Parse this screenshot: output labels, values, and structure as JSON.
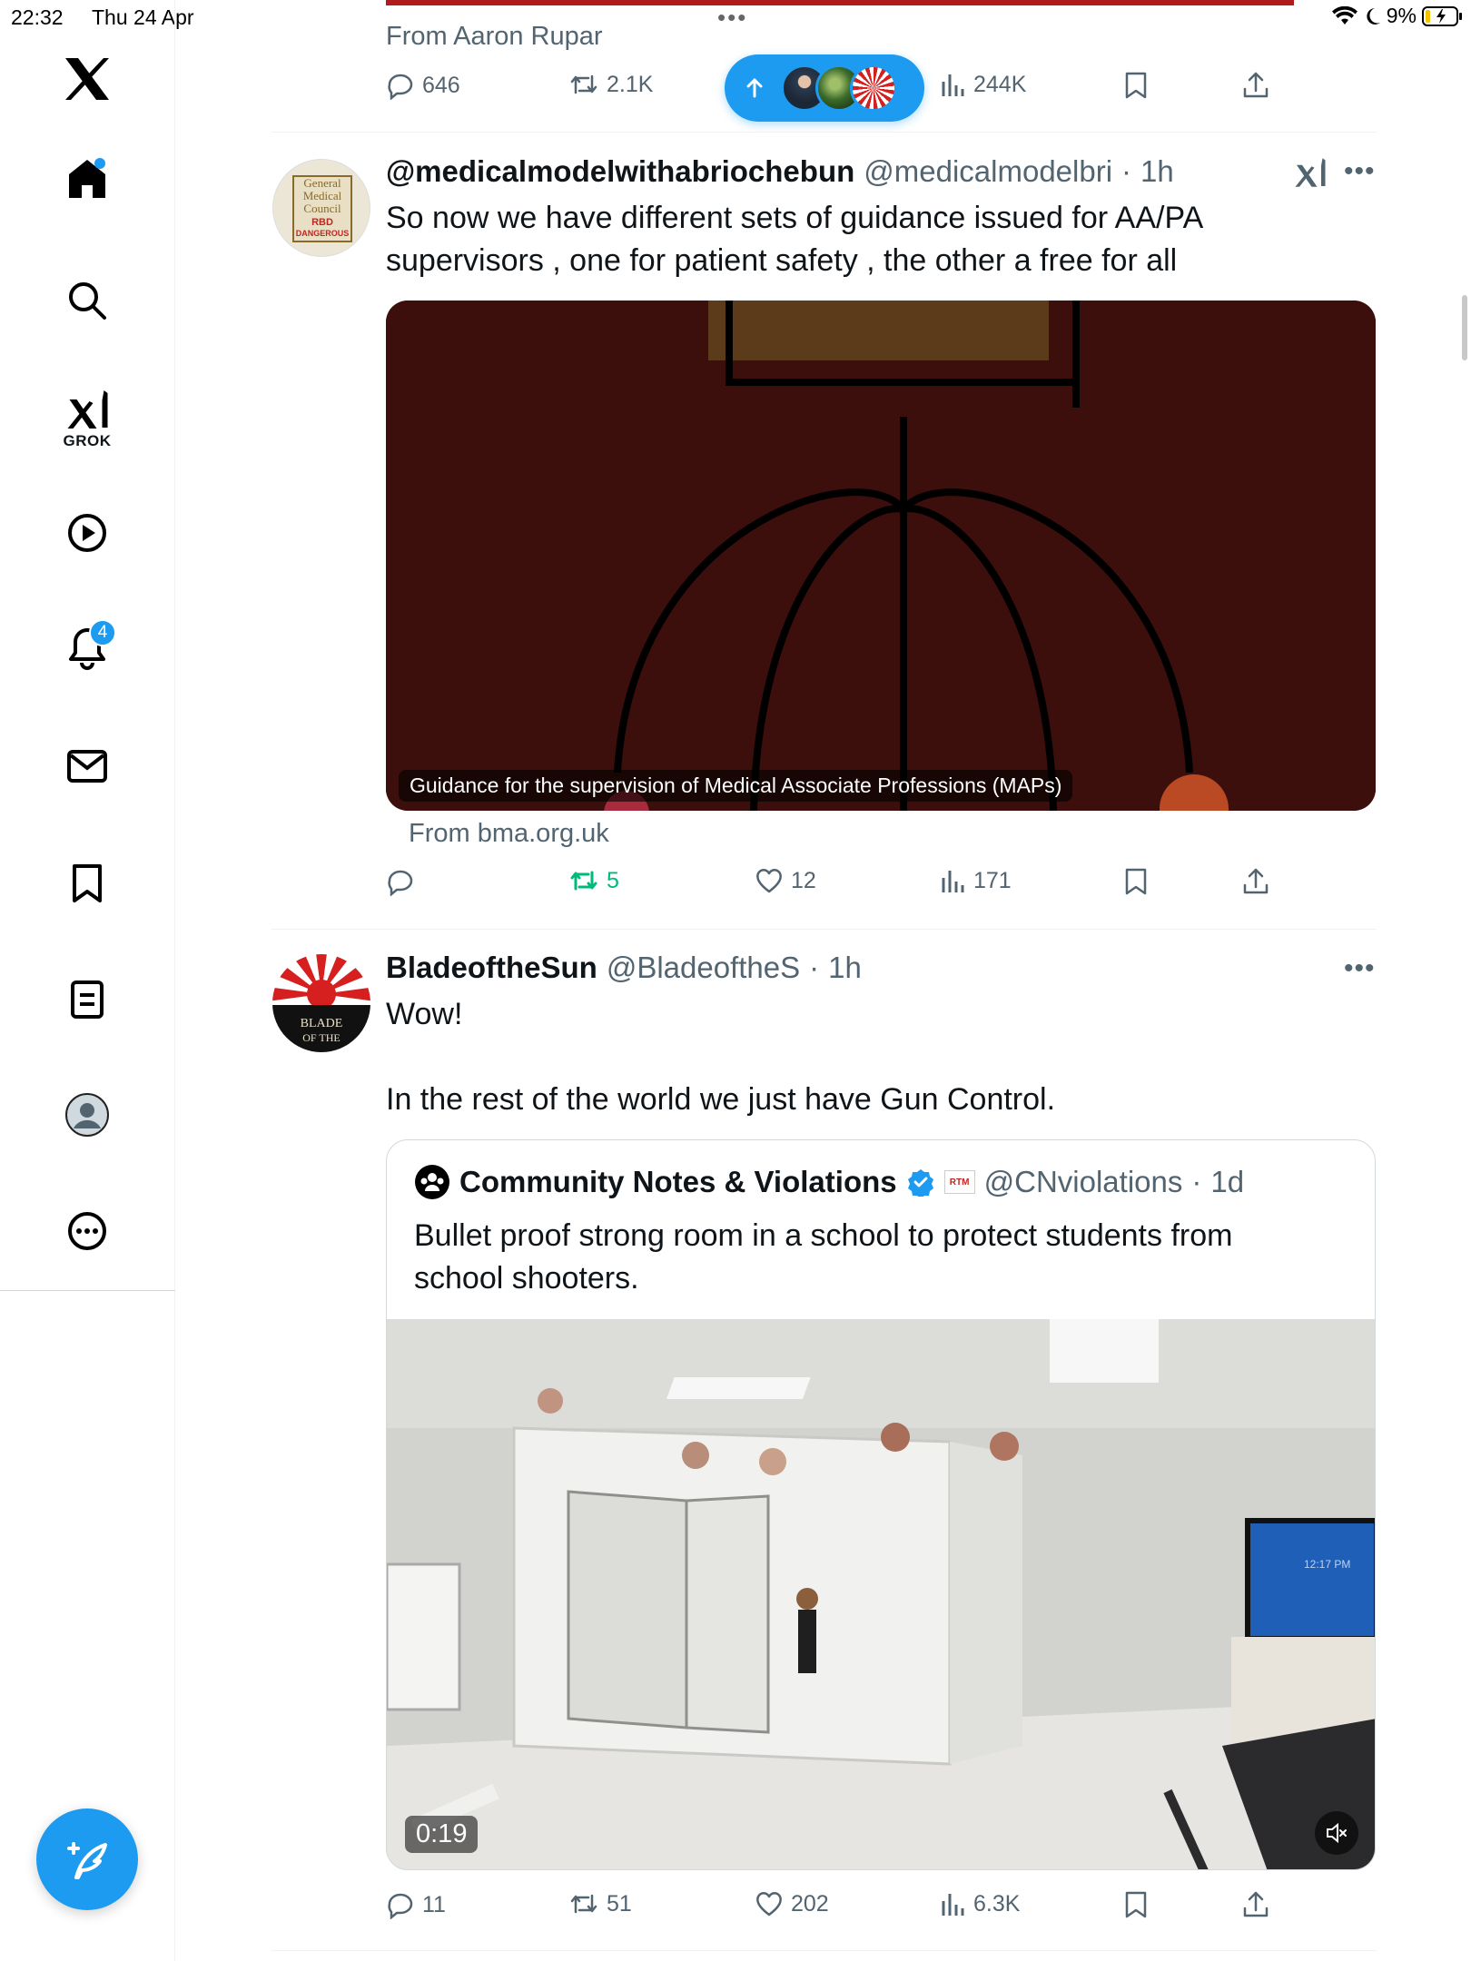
{
  "status_bar": {
    "time": "22:32",
    "date": "Thu 24 Apr",
    "battery": "9%"
  },
  "sidebar": {
    "grok_label": "GROK",
    "notifications_count": "4"
  },
  "top_post": {
    "from_label": "From Aaron Rupar",
    "replies": "646",
    "reposts": "2.1K",
    "views": "244K"
  },
  "post1": {
    "display_name": "@medicalmodelwithabriochebun",
    "handle": "@medicalmodelbri",
    "sep": "·",
    "time": "1h",
    "text_line1": "So now we have different sets of guidance issued for AA/PA",
    "text_line2": "supervisors , one for patient safety , the other a free for all",
    "card_caption": "Guidance for the supervision of Medical Associate Professions (MAPs)",
    "card_from": "From bma.org.uk",
    "reposts": "5",
    "likes": "12",
    "views": "171",
    "avatar_text": [
      "General",
      "Medical",
      "Council",
      "RBD",
      "DANGEROUS"
    ]
  },
  "post2": {
    "display_name": "BladeoftheSun",
    "handle": "@BladeoftheS",
    "sep": "·",
    "time": "1h",
    "text_line1": "Wow!",
    "text_line2": "In the rest of the world we just have Gun Control.",
    "avatar_text": [
      "BLADE",
      "OF THE"
    ],
    "quote": {
      "display_name": "Community Notes & Violations",
      "badge": "RTM",
      "handle": "@CNviolations",
      "sep": "·",
      "time": "1d",
      "text_line1": "Bullet proof strong room in a school to protect students from",
      "text_line2": "school shooters.",
      "video_duration": "0:19",
      "screen_time": "12:17 PM"
    },
    "replies": "11",
    "reposts": "51",
    "likes": "202",
    "views": "6.3K"
  },
  "colors": {
    "accent": "#1d9bf0",
    "repost_active": "#00ba7c",
    "muted": "#536471"
  }
}
